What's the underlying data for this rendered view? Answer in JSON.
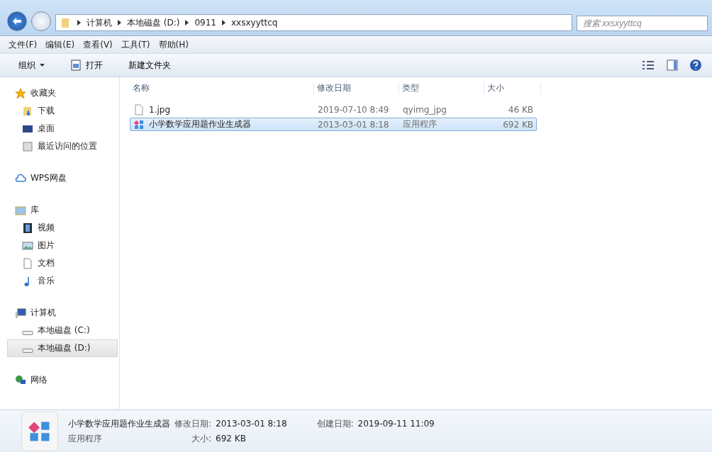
{
  "address_bar": {
    "path": [
      "计算机",
      "本地磁盘 (D:)",
      "0911",
      "xxsxyyttcq"
    ]
  },
  "search": {
    "placeholder": "搜索 xxsxyyttcq"
  },
  "menu": [
    "文件(F)",
    "编辑(E)",
    "查看(V)",
    "工具(T)",
    "帮助(H)"
  ],
  "toolbar": [
    {
      "label": "组织",
      "kind": "dropdown"
    },
    {
      "label": "打开",
      "kind": "icon"
    },
    {
      "label": "新建文件夹",
      "kind": "plain"
    }
  ],
  "sidebar": [
    {
      "label": "收藏夹",
      "selected": false,
      "children": [
        {
          "label": "下载",
          "selected": false
        },
        {
          "label": "桌面",
          "selected": false
        },
        {
          "label": "最近访问的位置",
          "selected": false
        }
      ]
    },
    {
      "label": "WPS网盘",
      "selected": false
    },
    {
      "label": "库",
      "selected": false,
      "children": [
        {
          "label": "视频",
          "selected": false
        },
        {
          "label": "图片",
          "selected": false
        },
        {
          "label": "文档",
          "selected": false
        },
        {
          "label": "音乐",
          "selected": false
        }
      ]
    },
    {
      "label": "计算机",
      "selected": false,
      "children": [
        {
          "label": "本地磁盘 (C:)",
          "selected": false
        },
        {
          "label": "本地磁盘 (D:)",
          "selected": true
        }
      ]
    },
    {
      "label": "网络",
      "selected": false
    }
  ],
  "table": {
    "columns": [
      "名称",
      "修改日期",
      "类型",
      "大小"
    ],
    "rows": [
      {
        "name": "1.jpg",
        "kind": "file",
        "modified": "2019-07-10 8:49",
        "type": "qyimg_jpg",
        "size": "46 KB",
        "selected": false
      },
      {
        "name": "小学数学应用题作业生成器",
        "kind": "app",
        "modified": "2013-03-01 8:18",
        "type": "应用程序",
        "size": "692 KB",
        "selected": true
      }
    ]
  },
  "details": {
    "name": "小学数学应用题作业生成器",
    "type": "应用程序",
    "modified_label": "修改日期:",
    "modified": "2013-03-01 8:18",
    "size_label": "大小:",
    "size": "692 KB",
    "created_label": "创建日期:",
    "created": "2019-09-11 11:09"
  }
}
